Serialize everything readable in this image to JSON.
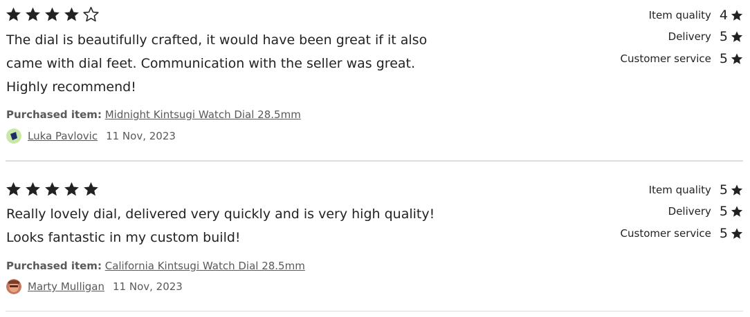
{
  "colors": {
    "text": "#222222",
    "muted": "#595959",
    "divider": "#dddddd",
    "star": "#222222"
  },
  "icons": {
    "star_filled": "star-icon",
    "star_empty": "star-outline-icon"
  },
  "reviews": [
    {
      "stars": 4,
      "text_lines": [
        "The dial is beautifully crafted, it would have been great if it also",
        "came with dial feet. Communication with the seller was great.",
        "Highly recommend!"
      ],
      "purchased_label": "Purchased item:",
      "item_name": "Midnight Kintsugi Watch Dial 28.5mm",
      "reviewer": "Luka Pavlovic",
      "date": "11 Nov, 2023",
      "ratings": [
        {
          "label": "Item quality",
          "value": "4"
        },
        {
          "label": "Delivery",
          "value": "5"
        },
        {
          "label": "Customer service",
          "value": "5"
        }
      ]
    },
    {
      "stars": 5,
      "text_lines": [
        "Really lovely dial, delivered very quickly and is very high quality!",
        "Looks fantastic in my custom build!"
      ],
      "purchased_label": "Purchased item:",
      "item_name": "California Kintsugi Watch Dial 28.5mm",
      "reviewer": "Marty Mulligan",
      "date": "11 Nov, 2023",
      "ratings": [
        {
          "label": "Item quality",
          "value": "5"
        },
        {
          "label": "Delivery",
          "value": "5"
        },
        {
          "label": "Customer service",
          "value": "5"
        }
      ]
    }
  ]
}
